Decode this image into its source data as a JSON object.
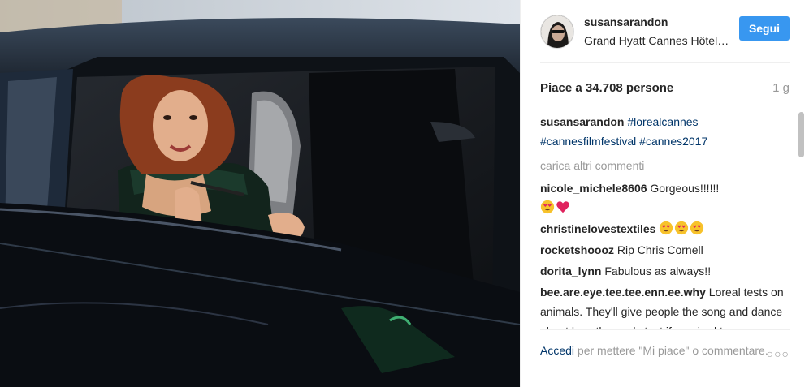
{
  "post": {
    "username": "susansarandon",
    "location": "Grand Hyatt Cannes Hôtel Martinez",
    "follow_label": "Segui",
    "likes_text": "Piace a 34.708 persone",
    "age": "1 g"
  },
  "caption": {
    "username": "susansarandon",
    "tags": [
      "#lorealcannes",
      "#cannesfilmfestival",
      "#cannes2017"
    ]
  },
  "load_more": "carica altri commenti",
  "comments": [
    {
      "user": "nicole_michele8606",
      "text": "Gorgeous!!!!!!",
      "emoji": [
        "heart-eyes",
        "red-heart"
      ]
    },
    {
      "user": "christinelovestextiles",
      "text": "",
      "emoji": [
        "heart-eyes",
        "heart-eyes",
        "heart-eyes"
      ]
    },
    {
      "user": "rocketshoooz",
      "text": "Rip Chris Cornell",
      "emoji": []
    },
    {
      "user": "dorita_lynn",
      "text": "Fabulous as always!!",
      "emoji": []
    },
    {
      "user": "bee.are.eye.tee.tee.enn.ee.why",
      "text": "Loreal tests on animals. They'll give people the song and dance about how they only test if required to...",
      "emoji": []
    }
  ],
  "footer": {
    "login_link": "Accedi",
    "rest": " per mettere \"Mi piace\" o commentare.",
    "more": "○○○"
  },
  "colors": {
    "follow_button": "#3897f0",
    "link": "#003569",
    "muted": "#999999"
  }
}
